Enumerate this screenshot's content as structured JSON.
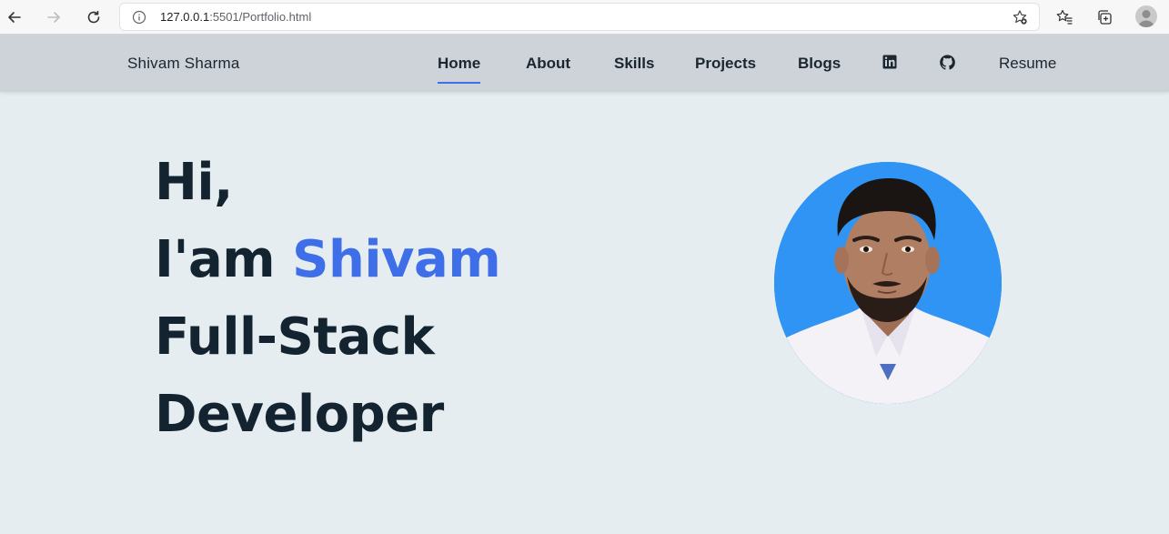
{
  "browser": {
    "url_host": "127.0.0.1",
    "url_rest": ":5501/Portfolio.html",
    "icons": [
      "back-icon",
      "forward-icon",
      "reload-icon",
      "info-icon",
      "add-favorite-icon",
      "favorites-icon",
      "collections-icon",
      "profile-icon"
    ]
  },
  "header": {
    "brand": "Shivam Sharma",
    "nav": {
      "home": "Home",
      "about": "About",
      "skills": "Skills",
      "projects": "Projects",
      "blogs": "Blogs",
      "resume": "Resume"
    },
    "icons": [
      "linkedin-icon",
      "github-icon"
    ]
  },
  "hero": {
    "line1": "Hi,",
    "line2_prefix": "I'am ",
    "line2_name": "Shivam",
    "line3": "Full-Stack",
    "line4": "Developer"
  },
  "colors": {
    "page_background": "#e6edf1",
    "header_background": "#cdd3d8",
    "accent": "#3f6fe8",
    "heading_text": "#13232f",
    "avatar_background": "#2f94f3"
  }
}
